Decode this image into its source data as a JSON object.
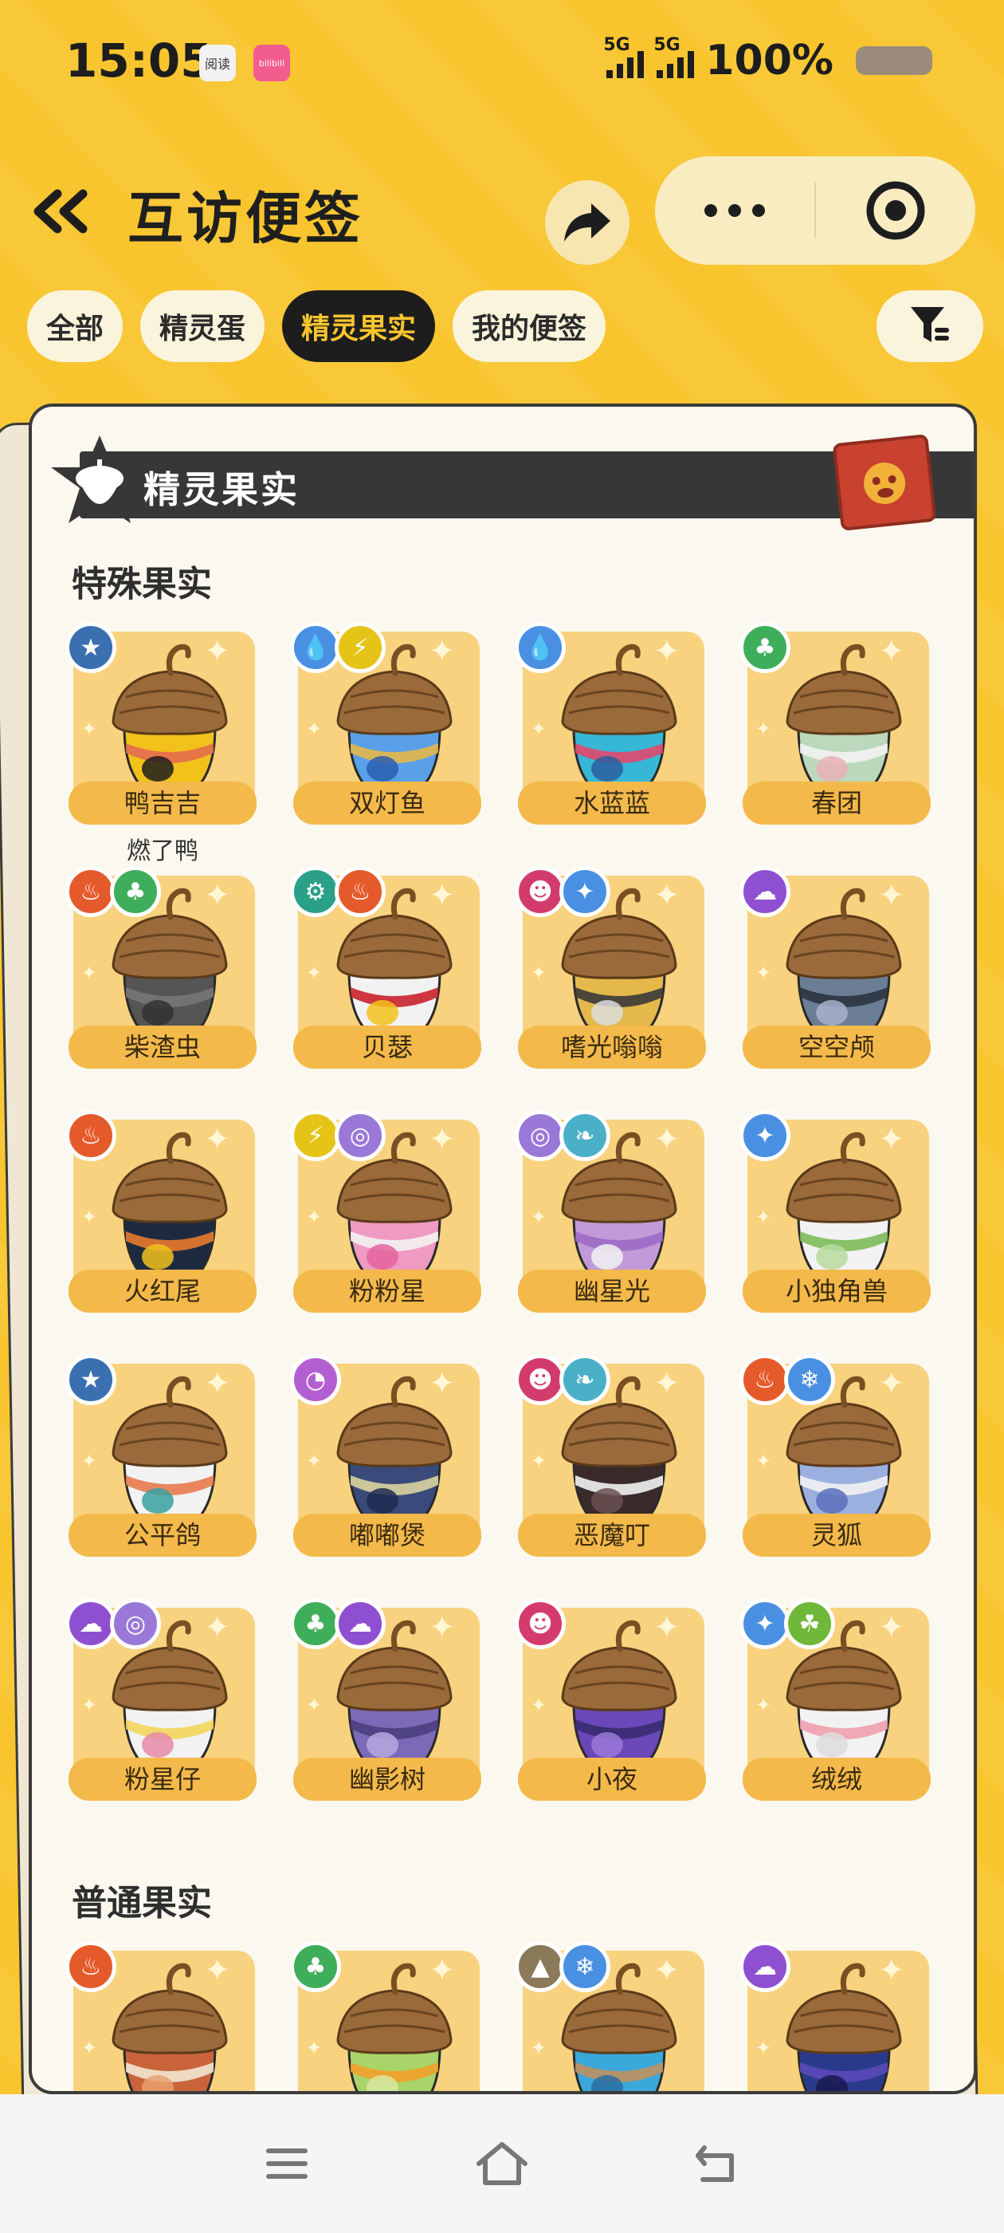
{
  "status": {
    "time": "15:05",
    "network_1": "5G",
    "network_2": "5G",
    "battery": "100%",
    "app_icon_1": "阅读",
    "app_icon_2": "bilibili"
  },
  "header": {
    "title": "互访便签"
  },
  "tabs": [
    {
      "label": "全部",
      "active": false
    },
    {
      "label": "精灵蛋",
      "active": false
    },
    {
      "label": "精灵果实",
      "active": true
    },
    {
      "label": "我的便签",
      "active": false
    }
  ],
  "card": {
    "banner_title": "精灵果实",
    "section_special": "特殊果实",
    "section_normal": "普通果实"
  },
  "special_fruits": [
    {
      "name": "鸭吉吉",
      "sub": "燃了鸭",
      "types": [
        "#3a6fb0:★"
      ],
      "colors": [
        "#f2c21b",
        "#e46b4c",
        "#1d1d1d"
      ]
    },
    {
      "name": "双灯鱼",
      "sub": "",
      "types": [
        "#4a90e2:💧",
        "#e6c417:⚡"
      ],
      "colors": [
        "#5aa0e8",
        "#e4b84a",
        "#2a5fb0"
      ]
    },
    {
      "name": "水蓝蓝",
      "sub": "",
      "types": [
        "#4a90e2:💧"
      ],
      "colors": [
        "#36b7d6",
        "#e2486b",
        "#2a5fa0"
      ]
    },
    {
      "name": "春团",
      "sub": "",
      "types": [
        "#3fae5a:♣"
      ],
      "colors": [
        "#bcd9bd",
        "#f2f2f2",
        "#e8b2b6"
      ]
    },
    {
      "name": "柴渣虫",
      "sub": "",
      "types": [
        "#e55a2b:♨",
        "#3fae5a:♣"
      ],
      "colors": [
        "#555555",
        "#777777",
        "#333333"
      ]
    },
    {
      "name": "贝瑟",
      "sub": "",
      "types": [
        "#2aa088:⚙",
        "#e55a2b:♨"
      ],
      "colors": [
        "#f2f2f2",
        "#c8222c",
        "#f2c21b"
      ]
    },
    {
      "name": "嗜光嗡嗡",
      "sub": "",
      "types": [
        "#d33b6d:☻",
        "#4a90e2:✦"
      ],
      "colors": [
        "#e4b84a",
        "#3a3a3a",
        "#dddddd"
      ]
    },
    {
      "name": "空空颅",
      "sub": "",
      "types": [
        "#8f4fd1:☁"
      ],
      "colors": [
        "#6c7d96",
        "#2c3540",
        "#a7b0ca"
      ]
    },
    {
      "name": "火红尾",
      "sub": "",
      "types": [
        "#e55a2b:♨"
      ],
      "colors": [
        "#1d2a40",
        "#e87a2c",
        "#f2c21b"
      ]
    },
    {
      "name": "粉粉星",
      "sub": "",
      "types": [
        "#e6c417:⚡",
        "#9a78d8:◎"
      ],
      "colors": [
        "#ef9ac1",
        "#f2f2f2",
        "#e4639d"
      ]
    },
    {
      "name": "幽星光",
      "sub": "",
      "types": [
        "#9a78d8:◎",
        "#4ab0c8:❧"
      ],
      "colors": [
        "#c39ad9",
        "#9c6bc5",
        "#f2f2f2"
      ]
    },
    {
      "name": "小独角兽",
      "sub": "",
      "types": [
        "#4a90e2:✦"
      ],
      "colors": [
        "#f2f2f2",
        "#7dbb59",
        "#b8dca0"
      ]
    },
    {
      "name": "公平鸽",
      "sub": "",
      "types": [
        "#3a6fb0:★"
      ],
      "colors": [
        "#f2f2f2",
        "#e87a4c",
        "#3aa0a0"
      ]
    },
    {
      "name": "嘟嘟煲",
      "sub": "",
      "types": [
        "#b45fd1:◔"
      ],
      "colors": [
        "#3a4a7a",
        "#d9d4a0",
        "#1d2a50"
      ]
    },
    {
      "name": "恶魔叮",
      "sub": "",
      "types": [
        "#d33b6d:☻",
        "#4ab0c8:❧"
      ],
      "colors": [
        "#3a2a2a",
        "#f2f2f2",
        "#6a5050"
      ]
    },
    {
      "name": "灵狐",
      "sub": "",
      "types": [
        "#e55a2b:♨",
        "#4a90e2:❄"
      ],
      "colors": [
        "#9cb0e0",
        "#f2f2f2",
        "#5a70b8"
      ]
    },
    {
      "name": "粉星仔",
      "sub": "",
      "types": [
        "#8f4fd1:☁",
        "#9a78d8:◎"
      ],
      "colors": [
        "#f2f2f2",
        "#f2d65a",
        "#e88aa8"
      ]
    },
    {
      "name": "幽影树",
      "sub": "",
      "types": [
        "#3fae5a:♣",
        "#8f4fd1:☁"
      ],
      "colors": [
        "#7b6ab8",
        "#4a3f80",
        "#b7a8e0"
      ]
    },
    {
      "name": "小夜",
      "sub": "",
      "types": [
        "#d33b6d:☻"
      ],
      "colors": [
        "#6a48b8",
        "#3a2a70",
        "#9a7ad8"
      ]
    },
    {
      "name": "绒绒",
      "sub": "",
      "types": [
        "#4a90e2:✦",
        "#6fb83a:☘"
      ],
      "colors": [
        "#f2f2f2",
        "#f0a0b0",
        "#dddddd"
      ]
    }
  ],
  "normal_fruits": [
    {
      "name": "",
      "types": [
        "#e55a2b:♨"
      ],
      "colors": [
        "#c9643a",
        "#f2e6d0",
        "#e8a070"
      ]
    },
    {
      "name": "",
      "types": [
        "#3fae5a:♣"
      ],
      "colors": [
        "#a8d46a",
        "#f2a02a",
        "#d8e8a0"
      ]
    },
    {
      "name": "",
      "types": [
        "#8b7a5a:▲",
        "#4a90e2:❄"
      ],
      "colors": [
        "#3aa8d8",
        "#c09060",
        "#2a6fa0"
      ]
    },
    {
      "name": "",
      "types": [
        "#8f4fd1:☁"
      ],
      "colors": [
        "#2a3a8a",
        "#5a4ab8",
        "#1a1a50"
      ]
    }
  ],
  "colors": {
    "background": "#f8c52e",
    "tab_active_bg": "#1d1d1d",
    "tab_active_text": "#f8c52e",
    "tile": "#f8d27f",
    "name_pill": "#f3b94a"
  },
  "icons": [
    "back-icon",
    "share-icon",
    "more-icon",
    "target-icon",
    "filter-icon",
    "acorn-badge-icon",
    "stamp-icon",
    "menu-icon",
    "home-icon",
    "return-icon"
  ]
}
